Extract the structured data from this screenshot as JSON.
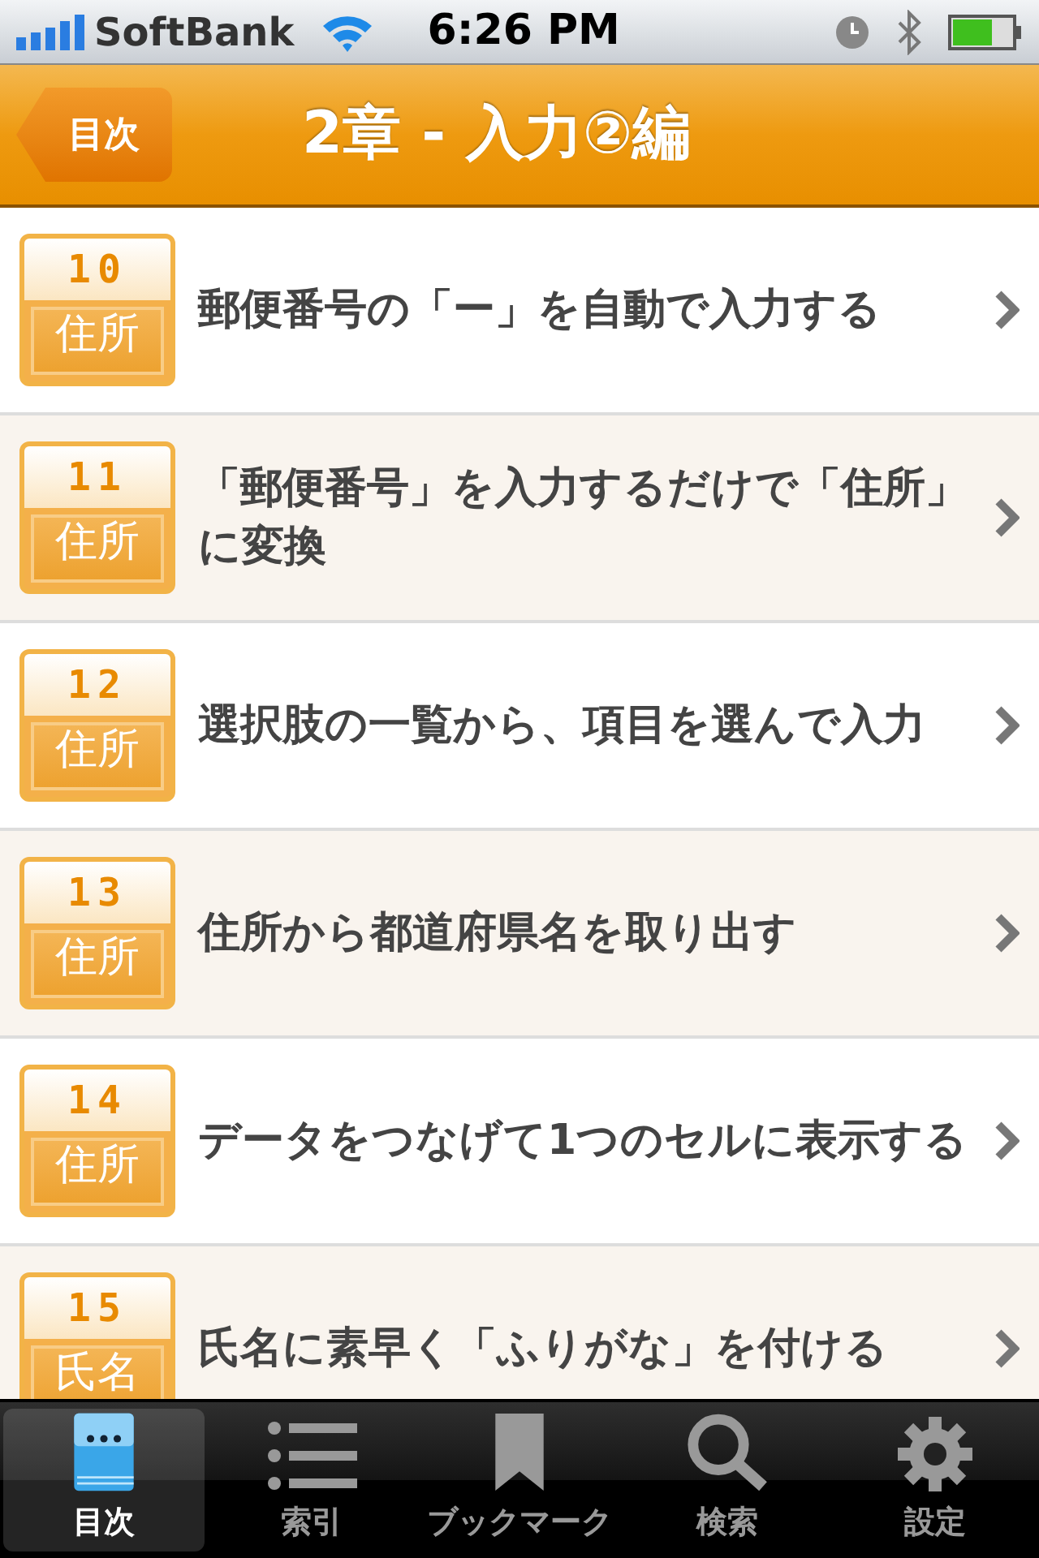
{
  "status_bar": {
    "carrier": "SoftBank",
    "time": "6:26 PM"
  },
  "nav": {
    "back": "目次",
    "title": "2章 - 入力②編"
  },
  "rows": [
    {
      "number": "10",
      "category": "住所",
      "title": "郵便番号の「ー」を自動で入力する"
    },
    {
      "number": "11",
      "category": "住所",
      "title": "「郵便番号」を入力するだけで「住所」に変換"
    },
    {
      "number": "12",
      "category": "住所",
      "title": "選択肢の一覧から、項目を選んで入力"
    },
    {
      "number": "13",
      "category": "住所",
      "title": "住所から都道府県名を取り出す"
    },
    {
      "number": "14",
      "category": "住所",
      "title": "データをつなげて1つのセルに表示する"
    },
    {
      "number": "15",
      "category": "氏名",
      "title": "氏名に素早く「ふりがな」を付ける"
    }
  ],
  "tabs": [
    {
      "kind": "book",
      "label": "目次",
      "selected": true
    },
    {
      "kind": "list",
      "label": "索引",
      "selected": false
    },
    {
      "kind": "bookmark",
      "label": "ブックマーク",
      "selected": false
    },
    {
      "kind": "search",
      "label": "検索",
      "selected": false
    },
    {
      "kind": "settings",
      "label": "設定",
      "selected": false
    }
  ]
}
